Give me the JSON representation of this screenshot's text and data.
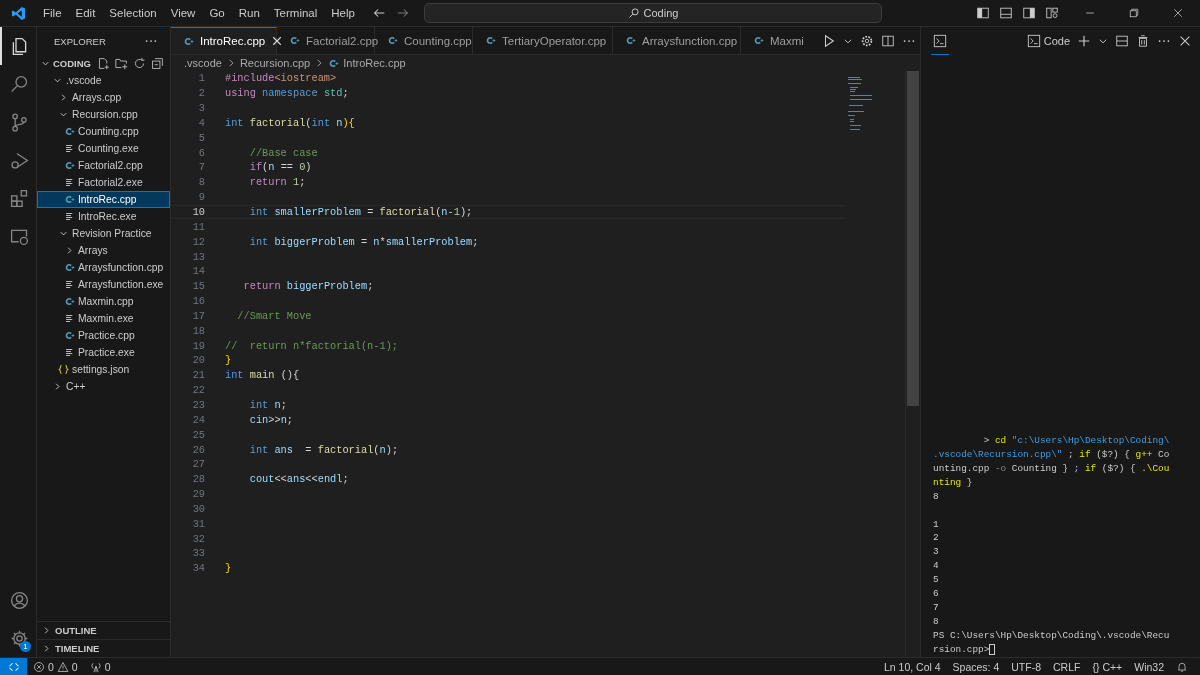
{
  "title_bar": {
    "menus": [
      "File",
      "Edit",
      "Selection",
      "View",
      "Go",
      "Run",
      "Terminal",
      "Help"
    ],
    "search": {
      "value": "Coding"
    }
  },
  "activity_bar": [
    {
      "kind": "explorer",
      "selected": true
    },
    {
      "kind": "search",
      "selected": false
    },
    {
      "kind": "source-control",
      "selected": false
    },
    {
      "kind": "run-debug",
      "selected": false
    },
    {
      "kind": "extensions",
      "selected": false
    },
    {
      "kind": "remote",
      "selected": false
    }
  ],
  "settings_badge": "1",
  "sidebar": {
    "title": "EXPLORER",
    "root": {
      "label": "CODING",
      "expanded": true
    },
    "tree": [
      {
        "label": ".vscode",
        "kind": "folder",
        "expanded": true,
        "selected": false,
        "children": [
          {
            "label": "Arrays.cpp",
            "kind": "folder",
            "expanded": false,
            "selected": false
          },
          {
            "label": "Recursion.cpp",
            "kind": "folder",
            "expanded": true,
            "selected": false,
            "children": [
              {
                "label": "Counting.cpp",
                "kind": "cpp",
                "selected": false
              },
              {
                "label": "Counting.exe",
                "kind": "exe",
                "selected": false
              },
              {
                "label": "Factorial2.cpp",
                "kind": "cpp",
                "selected": false
              },
              {
                "label": "Factorial2.exe",
                "kind": "exe",
                "selected": false
              },
              {
                "label": "IntroRec.cpp",
                "kind": "cpp",
                "selected": true
              },
              {
                "label": "IntroRec.exe",
                "kind": "exe",
                "selected": false
              }
            ]
          },
          {
            "label": "Revision Practice",
            "kind": "folder",
            "expanded": true,
            "selected": false,
            "children": [
              {
                "label": "Arrays",
                "kind": "folder",
                "expanded": false,
                "selected": false
              },
              {
                "label": "Arraysfunction.cpp",
                "kind": "cpp",
                "selected": false
              },
              {
                "label": "Arraysfunction.exe",
                "kind": "exe",
                "selected": false
              },
              {
                "label": "Maxmin.cpp",
                "kind": "cpp",
                "selected": false
              },
              {
                "label": "Maxmin.exe",
                "kind": "exe",
                "selected": false
              },
              {
                "label": "Practice.cpp",
                "kind": "cpp",
                "selected": false
              },
              {
                "label": "Practice.exe",
                "kind": "exe",
                "selected": false
              }
            ]
          },
          {
            "label": "settings.json",
            "kind": "json",
            "selected": false
          }
        ]
      },
      {
        "label": "C++",
        "kind": "folder",
        "expanded": false,
        "selected": false
      }
    ],
    "sections": [
      {
        "label": "OUTLINE",
        "expanded": false
      },
      {
        "label": "TIMELINE",
        "expanded": false
      }
    ]
  },
  "editor": {
    "tabs": [
      {
        "label": "IntroRec.cpp",
        "selected": true
      },
      {
        "label": "Factorial2.cpp",
        "selected": false
      },
      {
        "label": "Counting.cpp",
        "selected": false
      },
      {
        "label": "TertiaryOperator.cpp",
        "selected": false
      },
      {
        "label": "Arraysfunction.cpp",
        "selected": false
      },
      {
        "label": "Maxmi",
        "selected": false
      }
    ],
    "breadcrumb": [
      ".vscode",
      "Recursion.cpp",
      "IntroRec.cpp"
    ],
    "lines": [
      {
        "n": "1",
        "current": false,
        "tokens": [
          {
            "t": "#include",
            "kind": "control"
          },
          {
            "t": "<iostream>",
            "kind": "string"
          }
        ]
      },
      {
        "n": "2",
        "current": false,
        "tokens": [
          {
            "t": "using",
            "kind": "control"
          },
          {
            "t": " namespace",
            "kind": "keyword"
          },
          {
            "t": " std",
            "kind": "type"
          },
          {
            "t": ";",
            "kind": "plain"
          }
        ]
      },
      {
        "n": "3",
        "current": false
      },
      {
        "n": "4",
        "current": false,
        "tokens": [
          {
            "t": "int",
            "kind": "keyword"
          },
          {
            "t": " factorial",
            "kind": "function"
          },
          {
            "t": "(",
            "kind": "plain"
          },
          {
            "t": "int",
            "kind": "keyword"
          },
          {
            "t": " n",
            "kind": "variable"
          },
          {
            "t": "){",
            "kind": "brace"
          }
        ]
      },
      {
        "n": "5",
        "current": false
      },
      {
        "n": "6",
        "current": false,
        "tokens": [
          {
            "t": "    //Base case",
            "kind": "comment"
          }
        ]
      },
      {
        "n": "7",
        "current": false,
        "tokens": [
          {
            "t": "    if",
            "kind": "control"
          },
          {
            "t": "(",
            "kind": "plain"
          },
          {
            "t": "n",
            "kind": "variable"
          },
          {
            "t": " == ",
            "kind": "plain"
          },
          {
            "t": "0",
            "kind": "number"
          },
          {
            "t": ")",
            "kind": "plain"
          }
        ]
      },
      {
        "n": "8",
        "current": false,
        "tokens": [
          {
            "t": "    return",
            "kind": "control"
          },
          {
            "t": " 1",
            "kind": "number"
          },
          {
            "t": ";",
            "kind": "plain"
          }
        ]
      },
      {
        "n": "9",
        "current": false
      },
      {
        "n": "10",
        "current": true,
        "tokens": [
          {
            "t": "    int",
            "kind": "keyword"
          },
          {
            "t": " smallerProblem",
            "kind": "variable"
          },
          {
            "t": " = ",
            "kind": "plain"
          },
          {
            "t": "factorial",
            "kind": "function"
          },
          {
            "t": "(",
            "kind": "plain"
          },
          {
            "t": "n",
            "kind": "variable"
          },
          {
            "t": "-",
            "kind": "plain"
          },
          {
            "t": "1",
            "kind": "number"
          },
          {
            "t": ");",
            "kind": "plain"
          }
        ]
      },
      {
        "n": "11",
        "current": false
      },
      {
        "n": "12",
        "current": false,
        "tokens": [
          {
            "t": "    int",
            "kind": "keyword"
          },
          {
            "t": " biggerProblem",
            "kind": "variable"
          },
          {
            "t": " = ",
            "kind": "plain"
          },
          {
            "t": "n",
            "kind": "variable"
          },
          {
            "t": "*",
            "kind": "plain"
          },
          {
            "t": "smallerProblem",
            "kind": "variable"
          },
          {
            "t": ";",
            "kind": "plain"
          }
        ]
      },
      {
        "n": "13",
        "current": false
      },
      {
        "n": "14",
        "current": false
      },
      {
        "n": "15",
        "current": false,
        "tokens": [
          {
            "t": "   return",
            "kind": "control"
          },
          {
            "t": " biggerProblem",
            "kind": "variable"
          },
          {
            "t": ";",
            "kind": "plain"
          }
        ]
      },
      {
        "n": "16",
        "current": false
      },
      {
        "n": "17",
        "current": false,
        "tokens": [
          {
            "t": "  //Smart Move",
            "kind": "comment"
          }
        ]
      },
      {
        "n": "18",
        "current": false
      },
      {
        "n": "19",
        "current": false,
        "tokens": [
          {
            "t": "//  return n*factorial(n-1);",
            "kind": "comment"
          }
        ]
      },
      {
        "n": "20",
        "current": false,
        "tokens": [
          {
            "t": "}",
            "kind": "brace"
          }
        ]
      },
      {
        "n": "21",
        "current": false,
        "tokens": [
          {
            "t": "int",
            "kind": "keyword"
          },
          {
            "t": " main",
            "kind": "function"
          },
          {
            "t": " (){",
            "kind": "plain"
          }
        ]
      },
      {
        "n": "22",
        "current": false
      },
      {
        "n": "23",
        "current": false,
        "tokens": [
          {
            "t": "    int",
            "kind": "keyword"
          },
          {
            "t": " n",
            "kind": "variable"
          },
          {
            "t": ";",
            "kind": "plain"
          }
        ]
      },
      {
        "n": "24",
        "current": false,
        "tokens": [
          {
            "t": "    cin",
            "kind": "variable"
          },
          {
            "t": ">>",
            "kind": "plain"
          },
          {
            "t": "n",
            "kind": "variable"
          },
          {
            "t": ";",
            "kind": "plain"
          }
        ]
      },
      {
        "n": "25",
        "current": false
      },
      {
        "n": "26",
        "current": false,
        "tokens": [
          {
            "t": "    int",
            "kind": "keyword"
          },
          {
            "t": " ans",
            "kind": "variable"
          },
          {
            "t": "  = ",
            "kind": "plain"
          },
          {
            "t": "factorial",
            "kind": "function"
          },
          {
            "t": "(",
            "kind": "plain"
          },
          {
            "t": "n",
            "kind": "variable"
          },
          {
            "t": ");",
            "kind": "plain"
          }
        ]
      },
      {
        "n": "27",
        "current": false
      },
      {
        "n": "28",
        "current": false,
        "tokens": [
          {
            "t": "    cout",
            "kind": "variable"
          },
          {
            "t": "<<",
            "kind": "plain"
          },
          {
            "t": "ans",
            "kind": "variable"
          },
          {
            "t": "<<",
            "kind": "plain"
          },
          {
            "t": "endl",
            "kind": "variable"
          },
          {
            "t": ";",
            "kind": "plain"
          }
        ]
      },
      {
        "n": "29",
        "current": false
      },
      {
        "n": "30",
        "current": false
      },
      {
        "n": "31",
        "current": false
      },
      {
        "n": "32",
        "current": false
      },
      {
        "n": "33",
        "current": false
      },
      {
        "n": "34",
        "current": false,
        "tokens": [
          {
            "t": "}",
            "kind": "brace"
          }
        ]
      }
    ]
  },
  "panel": {
    "terminal_name": "Code",
    "lines": [
      {
        "kind": "text",
        "tokens": [
          {
            "t": "         >",
            "kind": "plain"
          },
          {
            "t": " cd",
            "kind": "command"
          },
          {
            "t": " \"c:\\Users\\Hp\\Desktop\\Coding\\",
            "kind": "string"
          }
        ]
      },
      {
        "kind": "text",
        "tokens": [
          {
            "t": ".vscode\\Recursion.cpp\\\"",
            "kind": "string"
          },
          {
            "t": " ;",
            "kind": "plain"
          },
          {
            "t": " if",
            "kind": "command"
          },
          {
            "t": " ($?) {",
            "kind": "plain"
          },
          {
            "t": " g++",
            "kind": "command"
          },
          {
            "t": " Co",
            "kind": "plain"
          }
        ]
      },
      {
        "kind": "text",
        "tokens": [
          {
            "t": "unting.cpp",
            "kind": "plain"
          },
          {
            "t": " -o",
            "kind": "parameter"
          },
          {
            "t": " Counting } ;",
            "kind": "plain"
          },
          {
            "t": " if",
            "kind": "command"
          },
          {
            "t": " ($?) {",
            "kind": "plain"
          },
          {
            "t": " .\\Cou",
            "kind": "command"
          }
        ]
      },
      {
        "kind": "text",
        "tokens": [
          {
            "t": "nting",
            "kind": "command"
          },
          {
            "t": " }",
            "kind": "plain"
          }
        ]
      },
      {
        "kind": "text",
        "tokens": [
          {
            "t": "8",
            "kind": "plain"
          }
        ]
      },
      {
        "kind": "blank"
      },
      {
        "kind": "text",
        "tokens": [
          {
            "t": "1",
            "kind": "plain"
          }
        ]
      },
      {
        "kind": "text",
        "tokens": [
          {
            "t": "2",
            "kind": "plain"
          }
        ]
      },
      {
        "kind": "text",
        "tokens": [
          {
            "t": "3",
            "kind": "plain"
          }
        ]
      },
      {
        "kind": "text",
        "tokens": [
          {
            "t": "4",
            "kind": "plain"
          }
        ]
      },
      {
        "kind": "text",
        "tokens": [
          {
            "t": "5",
            "kind": "plain"
          }
        ]
      },
      {
        "kind": "text",
        "tokens": [
          {
            "t": "6",
            "kind": "plain"
          }
        ]
      },
      {
        "kind": "text",
        "tokens": [
          {
            "t": "7",
            "kind": "plain"
          }
        ]
      },
      {
        "kind": "text",
        "tokens": [
          {
            "t": "8",
            "kind": "plain"
          }
        ]
      },
      {
        "kind": "text",
        "tokens": [
          {
            "t": "PS C:\\Users\\Hp\\Desktop\\Coding\\.vscode\\Recu",
            "kind": "plain"
          }
        ]
      },
      {
        "kind": "prompt",
        "tokens": [
          {
            "t": "rsion.cpp>",
            "kind": "plain"
          }
        ]
      }
    ]
  },
  "status_bar": {
    "errors": "0",
    "warnings": "0",
    "ports": "0",
    "right": [
      "Ln 10, Col 4",
      "Spaces: 4",
      "UTF-8",
      "CRLF",
      "{} C++",
      "Win32"
    ]
  }
}
